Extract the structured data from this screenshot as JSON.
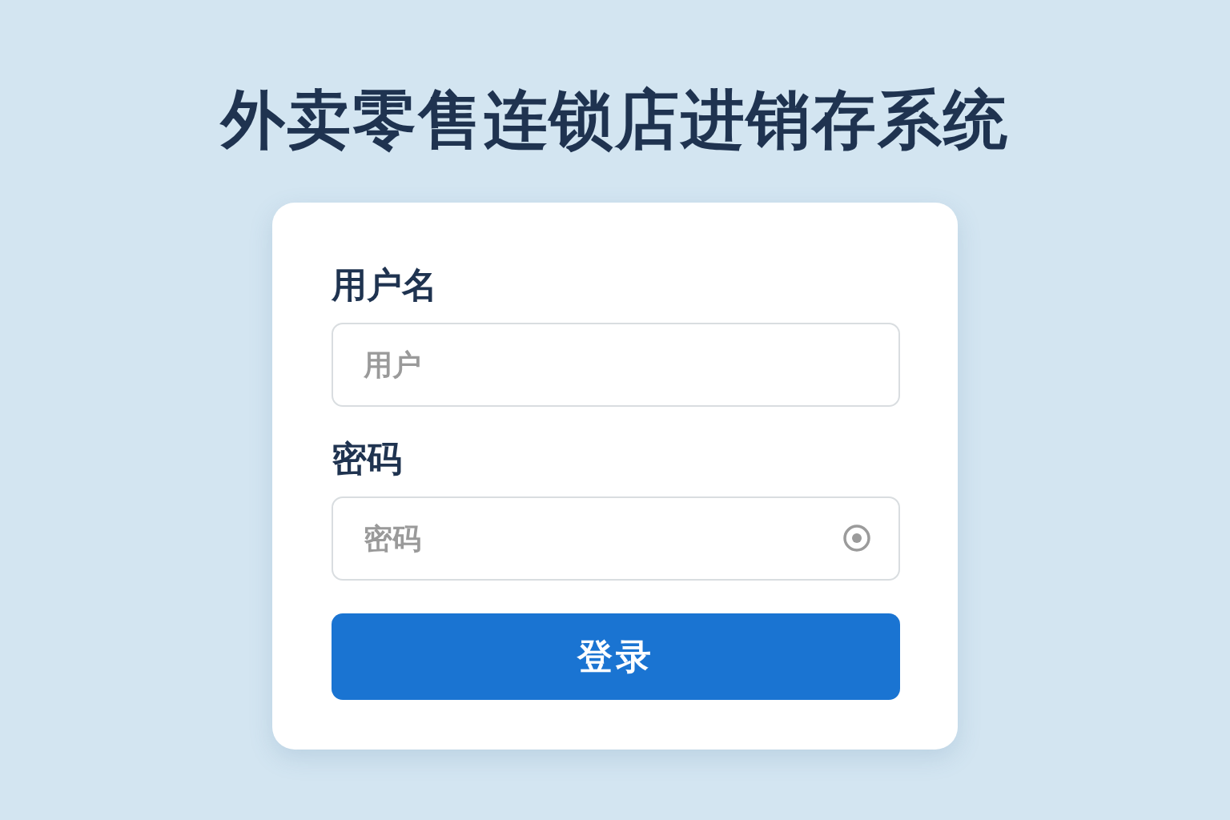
{
  "title": "外卖零售连锁店进销存系统",
  "fields": [
    {
      "label": "用户名",
      "placeholder": "用户",
      "kind": "text"
    },
    {
      "label": "密码",
      "placeholder": "密码",
      "kind": "password"
    }
  ],
  "submit": {
    "label": "登录"
  }
}
